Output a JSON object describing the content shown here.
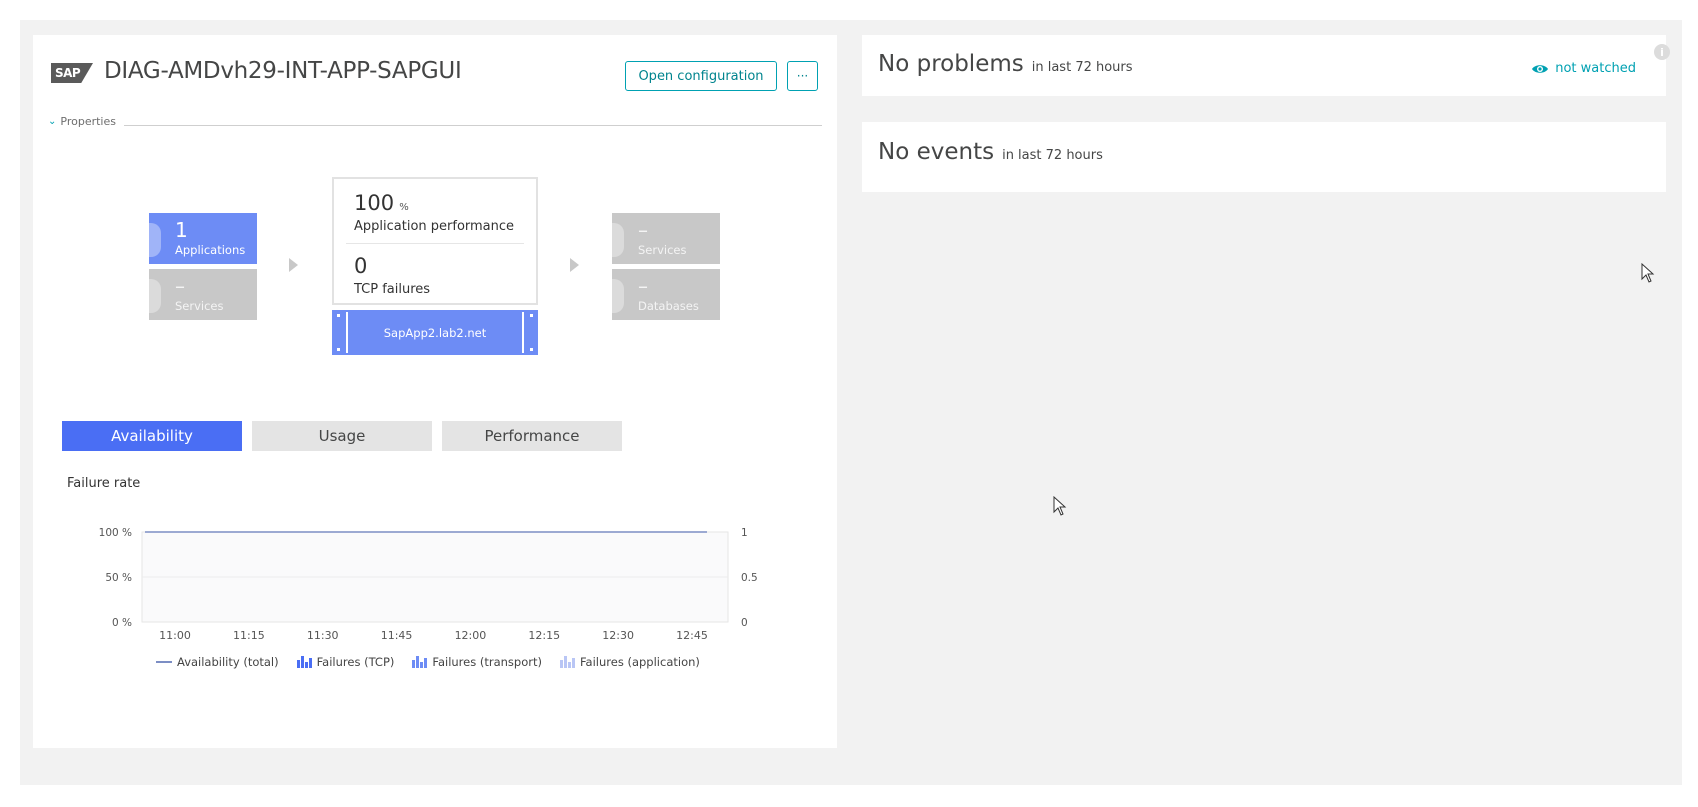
{
  "entity": {
    "logo_text": "SAP",
    "title": "DIAG-AMDvh29-INT-APP-SAPGUI",
    "open_configuration_label": "Open configuration",
    "more_label": "···",
    "properties_label": "Properties"
  },
  "topology": {
    "applications": {
      "value": "1",
      "label": "Applications"
    },
    "services_left": {
      "value": "–",
      "label": "Services"
    },
    "performance": {
      "value": "100",
      "unit": "%",
      "label": "Application performance"
    },
    "tcp": {
      "value": "0",
      "label": "TCP failures"
    },
    "host": {
      "label": "SapApp2.lab2.net"
    },
    "services_right": {
      "value": "–",
      "label": "Services"
    },
    "databases": {
      "value": "–",
      "label": "Databases"
    }
  },
  "tabs": [
    {
      "label": "Availability",
      "active": true
    },
    {
      "label": "Usage",
      "active": false
    },
    {
      "label": "Performance",
      "active": false
    }
  ],
  "chart_data": {
    "type": "line",
    "title": "Failure rate",
    "x": [
      "11:00",
      "11:15",
      "11:30",
      "11:45",
      "12:00",
      "12:15",
      "12:30",
      "12:45"
    ],
    "y_left_ticks": [
      "100 %",
      "50 %",
      "0 %"
    ],
    "y_right_ticks": [
      "1",
      "0.5",
      "0"
    ],
    "ylim": [
      0,
      100
    ],
    "series": [
      {
        "name": "Availability (total)",
        "kind": "line",
        "color": "#7c8ec4",
        "values": [
          100,
          100,
          100,
          100,
          100,
          100,
          100,
          100
        ]
      },
      {
        "name": "Failures (TCP)",
        "kind": "bar",
        "color": "#4a6ef4",
        "values": [
          0,
          0,
          0,
          0,
          0,
          0,
          0,
          0
        ]
      },
      {
        "name": "Failures (transport)",
        "kind": "bar",
        "color": "#6d8cf5",
        "values": [
          0,
          0,
          0,
          0,
          0,
          0,
          0,
          0
        ]
      },
      {
        "name": "Failures (application)",
        "kind": "bar",
        "color": "#b9c6f5",
        "values": [
          0,
          0,
          0,
          0,
          0,
          0,
          0,
          0
        ]
      }
    ]
  },
  "problems": {
    "title": "No problems",
    "range": "in last 72 hours",
    "watch_label": "not watched"
  },
  "events": {
    "title": "No events",
    "range": "in last 72 hours"
  },
  "colors": {
    "accent": "#00a1b2",
    "blue": "#4a6ef4",
    "tile_blue": "#6d8cf5",
    "grey": "#c8c8c8"
  }
}
